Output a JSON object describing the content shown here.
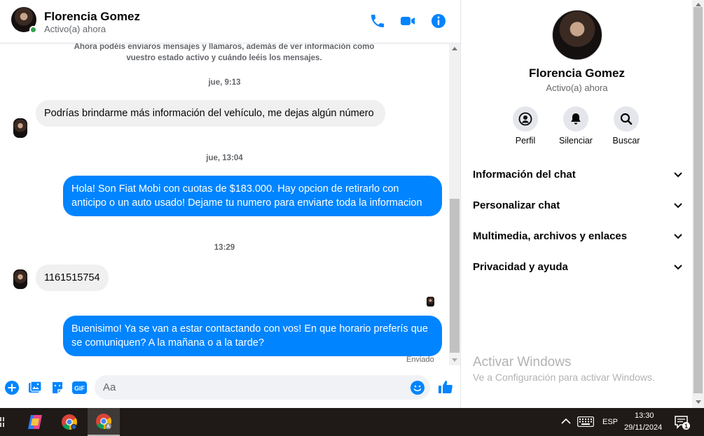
{
  "header": {
    "contact_name": "Florencia Gomez",
    "status": "Activo(a) ahora"
  },
  "system_note": "Ahora podéis enviaros mensajes y llamaros, además de ver información como vuestro estado activo y cuándo leéis los mensajes.",
  "messages": [
    {
      "type": "timestamp",
      "text": "jue, 9:13"
    },
    {
      "type": "in",
      "text": "Podrías brindarme más información del vehículo, me dejas algún número"
    },
    {
      "type": "timestamp",
      "text": "jue, 13:04"
    },
    {
      "type": "out",
      "text": "Hola! Son Fiat Mobi con cuotas de $183.000. Hay opcion de retirarlo con anticipo o un auto usado! Dejame tu numero para enviarte toda la informacion"
    },
    {
      "type": "timestamp",
      "text": "13:29"
    },
    {
      "type": "in",
      "text": "1161515754"
    },
    {
      "type": "out",
      "text": "Buenisimo! Ya se van a estar contactando con vos! En que horario preferís que se comuniquen? A la mañana o a la tarde?"
    }
  ],
  "sent_label": "Enviado",
  "composer": {
    "placeholder": "Aa",
    "gif_label": "GIF"
  },
  "info_panel": {
    "name": "Florencia Gomez",
    "status": "Activo(a) ahora",
    "actions": [
      {
        "label": "Perfil",
        "icon": "profile-icon"
      },
      {
        "label": "Silenciar",
        "icon": "bell-icon"
      },
      {
        "label": "Buscar",
        "icon": "search-icon"
      }
    ],
    "sections": [
      "Información del chat",
      "Personalizar chat",
      "Multimedia, archivos y enlaces",
      "Privacidad y ayuda"
    ]
  },
  "watermark": {
    "title": "Activar Windows",
    "subtitle": "Ve a Configuración para activar Windows."
  },
  "taskbar": {
    "language": "ESP",
    "time": "13:30",
    "date": "29/11/2024",
    "notification_count": "1",
    "chrome_badge_1": "A"
  },
  "colors": {
    "accent": "#0084ff",
    "incoming_bubble": "#f0f0f0",
    "online": "#31a24c"
  }
}
